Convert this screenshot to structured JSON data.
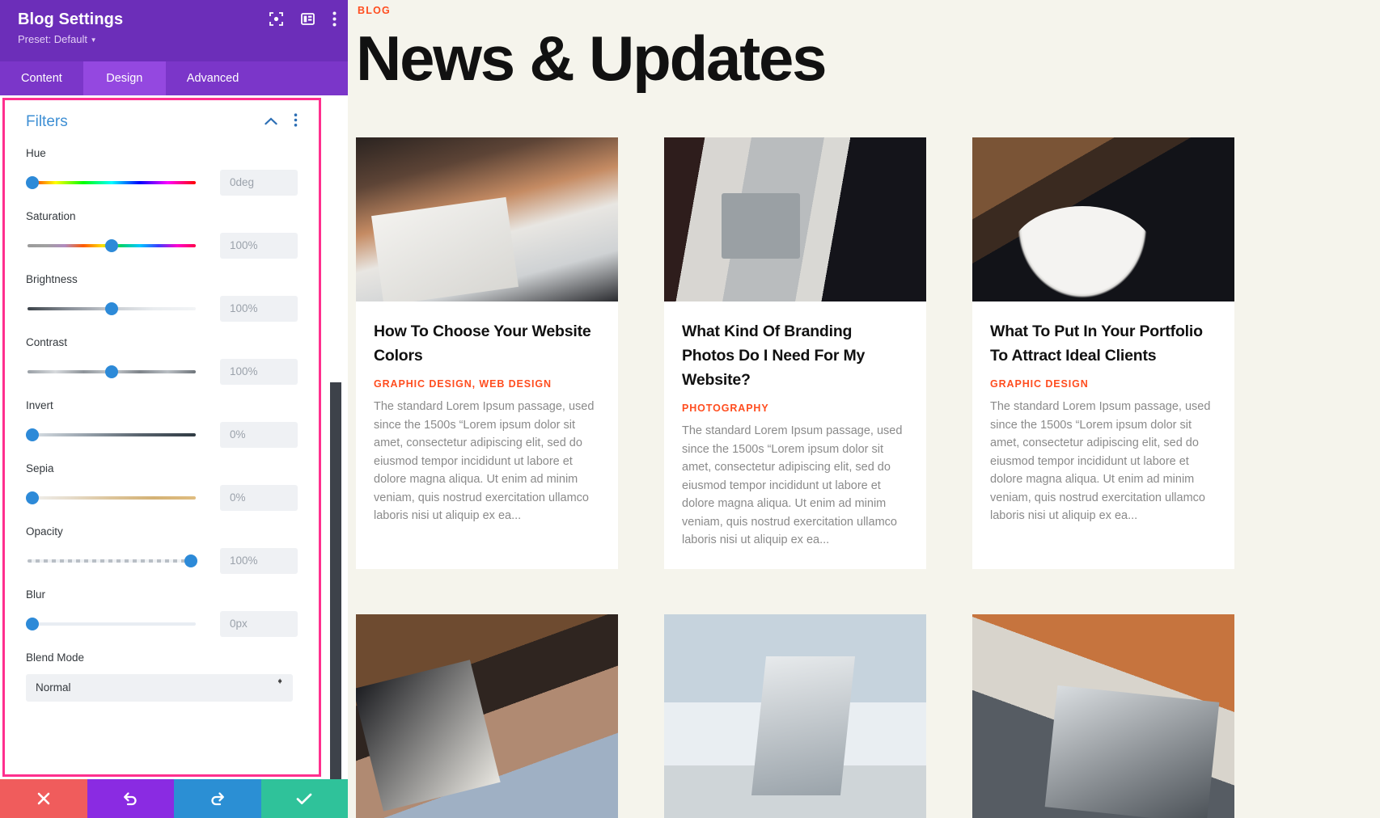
{
  "panel": {
    "title": "Blog Settings",
    "preset_label": "Preset: Default",
    "header_icons": [
      "focus-target-icon",
      "layout-panel-icon",
      "more-vertical-icon"
    ],
    "tabs": [
      {
        "label": "Content",
        "active": false
      },
      {
        "label": "Design",
        "active": true
      },
      {
        "label": "Advanced",
        "active": false
      }
    ],
    "section": {
      "title": "Filters",
      "collapse_icon": "chevron-up-icon",
      "menu_icon": "more-vertical-icon"
    },
    "fields": [
      {
        "label": "Hue",
        "value": "0deg",
        "knob_pct": 0,
        "track": "g-hue"
      },
      {
        "label": "Saturation",
        "value": "100%",
        "knob_pct": 50,
        "track": "g-sat"
      },
      {
        "label": "Brightness",
        "value": "100%",
        "knob_pct": 50,
        "track": "g-bri"
      },
      {
        "label": "Contrast",
        "value": "100%",
        "knob_pct": 50,
        "track": "g-con"
      },
      {
        "label": "Invert",
        "value": "0%",
        "knob_pct": 0,
        "track": "g-inv"
      },
      {
        "label": "Sepia",
        "value": "0%",
        "knob_pct": 0,
        "track": "g-sep"
      },
      {
        "label": "Opacity",
        "value": "100%",
        "knob_pct": 100,
        "track": "g-opa"
      },
      {
        "label": "Blur",
        "value": "0px",
        "knob_pct": 0,
        "track": "g-blur"
      }
    ],
    "blend_mode": {
      "label": "Blend Mode",
      "value": "Normal"
    },
    "footer": [
      {
        "name": "close-button",
        "icon": "x-icon",
        "color": "#f05c5c"
      },
      {
        "name": "undo-button",
        "icon": "undo-icon",
        "color": "#8a2be2"
      },
      {
        "name": "redo-button",
        "icon": "redo-icon",
        "color": "#2b8fd4"
      },
      {
        "name": "save-button",
        "icon": "check-icon",
        "color": "#2fc29a"
      }
    ],
    "colors": {
      "header_purple": "#6c2eb9",
      "tab_active": "#9448e0",
      "highlight_border": "#ff2f8e",
      "accent_blue": "#2d8ad8",
      "section_title": "#3e8fd4"
    }
  },
  "preview": {
    "eyebrow": "BLOG",
    "heading": "News & Updates",
    "accent_color": "#ff4d1f",
    "background": "#f5f4ec",
    "excerpt": "The standard Lorem Ipsum passage, used since the 1500s “Lorem ipsum dolor sit amet, consectetur adipiscing elit, sed do eiusmod tempor incididunt ut labore et dolore magna aliqua. Ut enim ad minim veniam, quis nostrud exercitation ullamco laboris nisi ut aliquip ex ea...",
    "row1": [
      {
        "title": "How To Choose Your Website Colors",
        "category": "GRAPHIC DESIGN, WEB DESIGN",
        "image": "desk-sketching-wireframe"
      },
      {
        "title": "What Kind Of Branding Photos Do I Need For My Website?",
        "category": "PHOTOGRAPHY",
        "image": "imac-by-window"
      },
      {
        "title": "What To Put In Your Portfolio To Attract Ideal Clients",
        "category": "GRAPHIC DESIGN",
        "image": "laptop-white-chair-desk"
      }
    ],
    "row2": [
      {
        "image": "woman-laptop-rug"
      },
      {
        "image": "laptop-coffee-window"
      },
      {
        "image": "hands-keyboard-notebook"
      }
    ]
  }
}
